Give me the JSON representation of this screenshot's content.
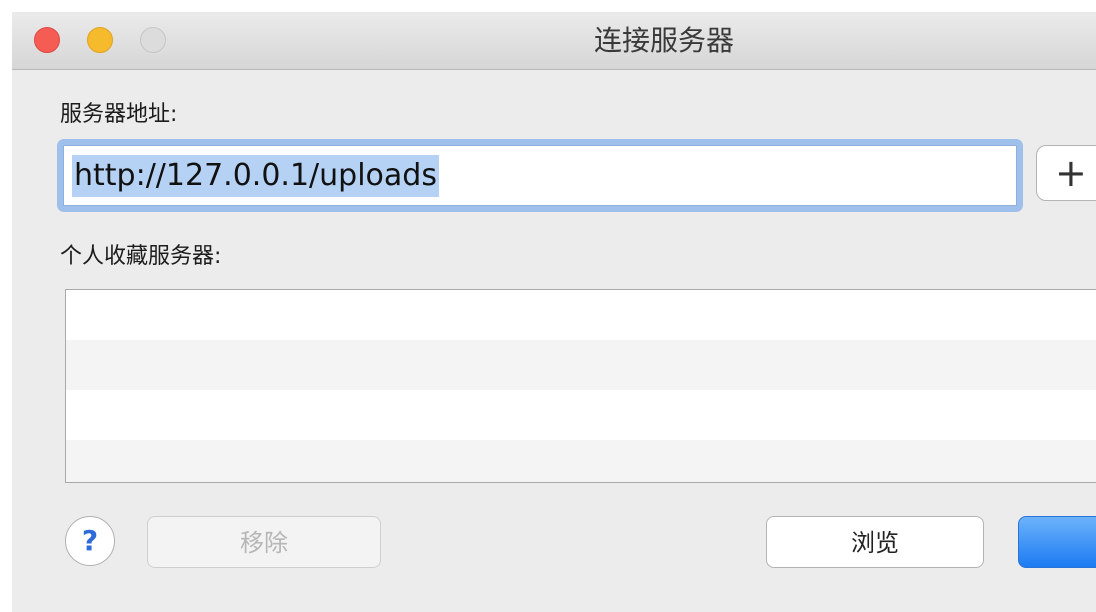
{
  "window": {
    "title": "连接服务器",
    "colors": {
      "close": "#f45c54",
      "minimize": "#f6bb2c",
      "zoom": "#dcdcdc",
      "primary": "#1d7bf2",
      "selection": "#b5d2f5"
    }
  },
  "server_address": {
    "label": "服务器地址:",
    "value": "http://127.0.0.1/uploads"
  },
  "add_button": {
    "label": "+"
  },
  "favorites": {
    "label": "个人收藏服务器:",
    "items": []
  },
  "buttons": {
    "help": "?",
    "remove": "移除",
    "browse": "浏览",
    "connect": ""
  }
}
